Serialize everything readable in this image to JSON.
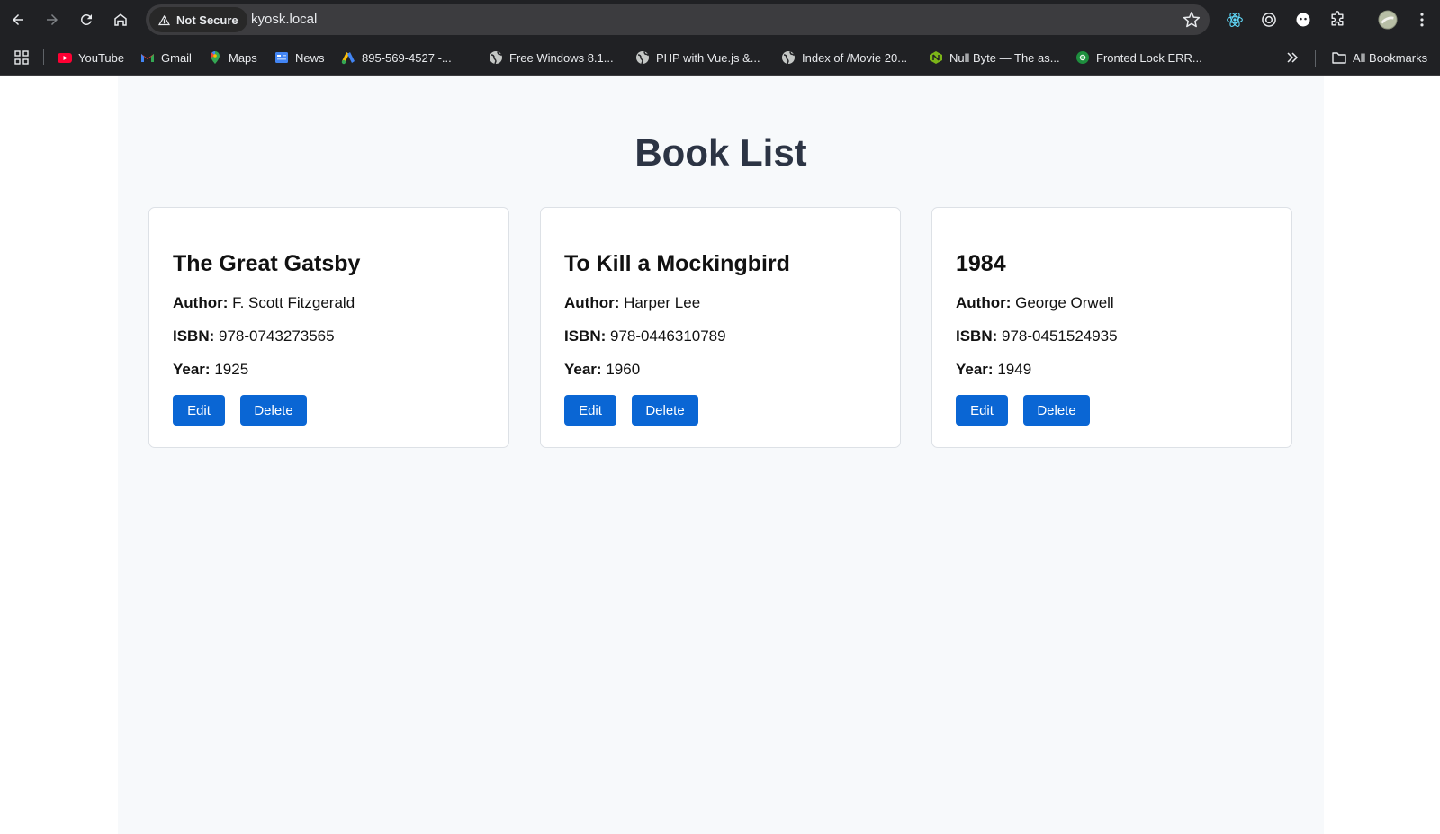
{
  "browser": {
    "security_label": "Not Secure",
    "url": "kyosk.local",
    "bookmarks": [
      {
        "label": "YouTube",
        "icon": "youtube-icon"
      },
      {
        "label": "Gmail",
        "icon": "gmail-icon"
      },
      {
        "label": "Maps",
        "icon": "maps-icon"
      },
      {
        "label": "News",
        "icon": "news-icon"
      },
      {
        "label": "895-569-4527 -...",
        "icon": "ads-icon"
      },
      {
        "label": "Free Windows 8.1...",
        "icon": "globe-icon"
      },
      {
        "label": "PHP with Vue.js &...",
        "icon": "globe-icon"
      },
      {
        "label": "Index of /Movie 20...",
        "icon": "globe-icon"
      },
      {
        "label": "Null Byte — The as...",
        "icon": "null-byte-icon"
      },
      {
        "label": "Fronted Lock ERR...",
        "icon": "chrome-green-icon"
      }
    ],
    "all_bookmarks_label": "All Bookmarks"
  },
  "page": {
    "title": "Book List",
    "labels": {
      "author": "Author:",
      "isbn": "ISBN:",
      "year": "Year:",
      "edit": "Edit",
      "delete": "Delete"
    },
    "books": [
      {
        "title": "The Great Gatsby",
        "author": "F. Scott Fitzgerald",
        "isbn": "978-0743273565",
        "year": "1925"
      },
      {
        "title": "To Kill a Mockingbird",
        "author": "Harper Lee",
        "isbn": "978-0446310789",
        "year": "1960"
      },
      {
        "title": "1984",
        "author": "George Orwell",
        "isbn": "978-0451524935",
        "year": "1949"
      }
    ]
  },
  "colors": {
    "chrome_bg": "#202124",
    "page_bg": "#f7f9fb",
    "title_color": "#2c3444",
    "button_bg": "#0a66d4"
  }
}
